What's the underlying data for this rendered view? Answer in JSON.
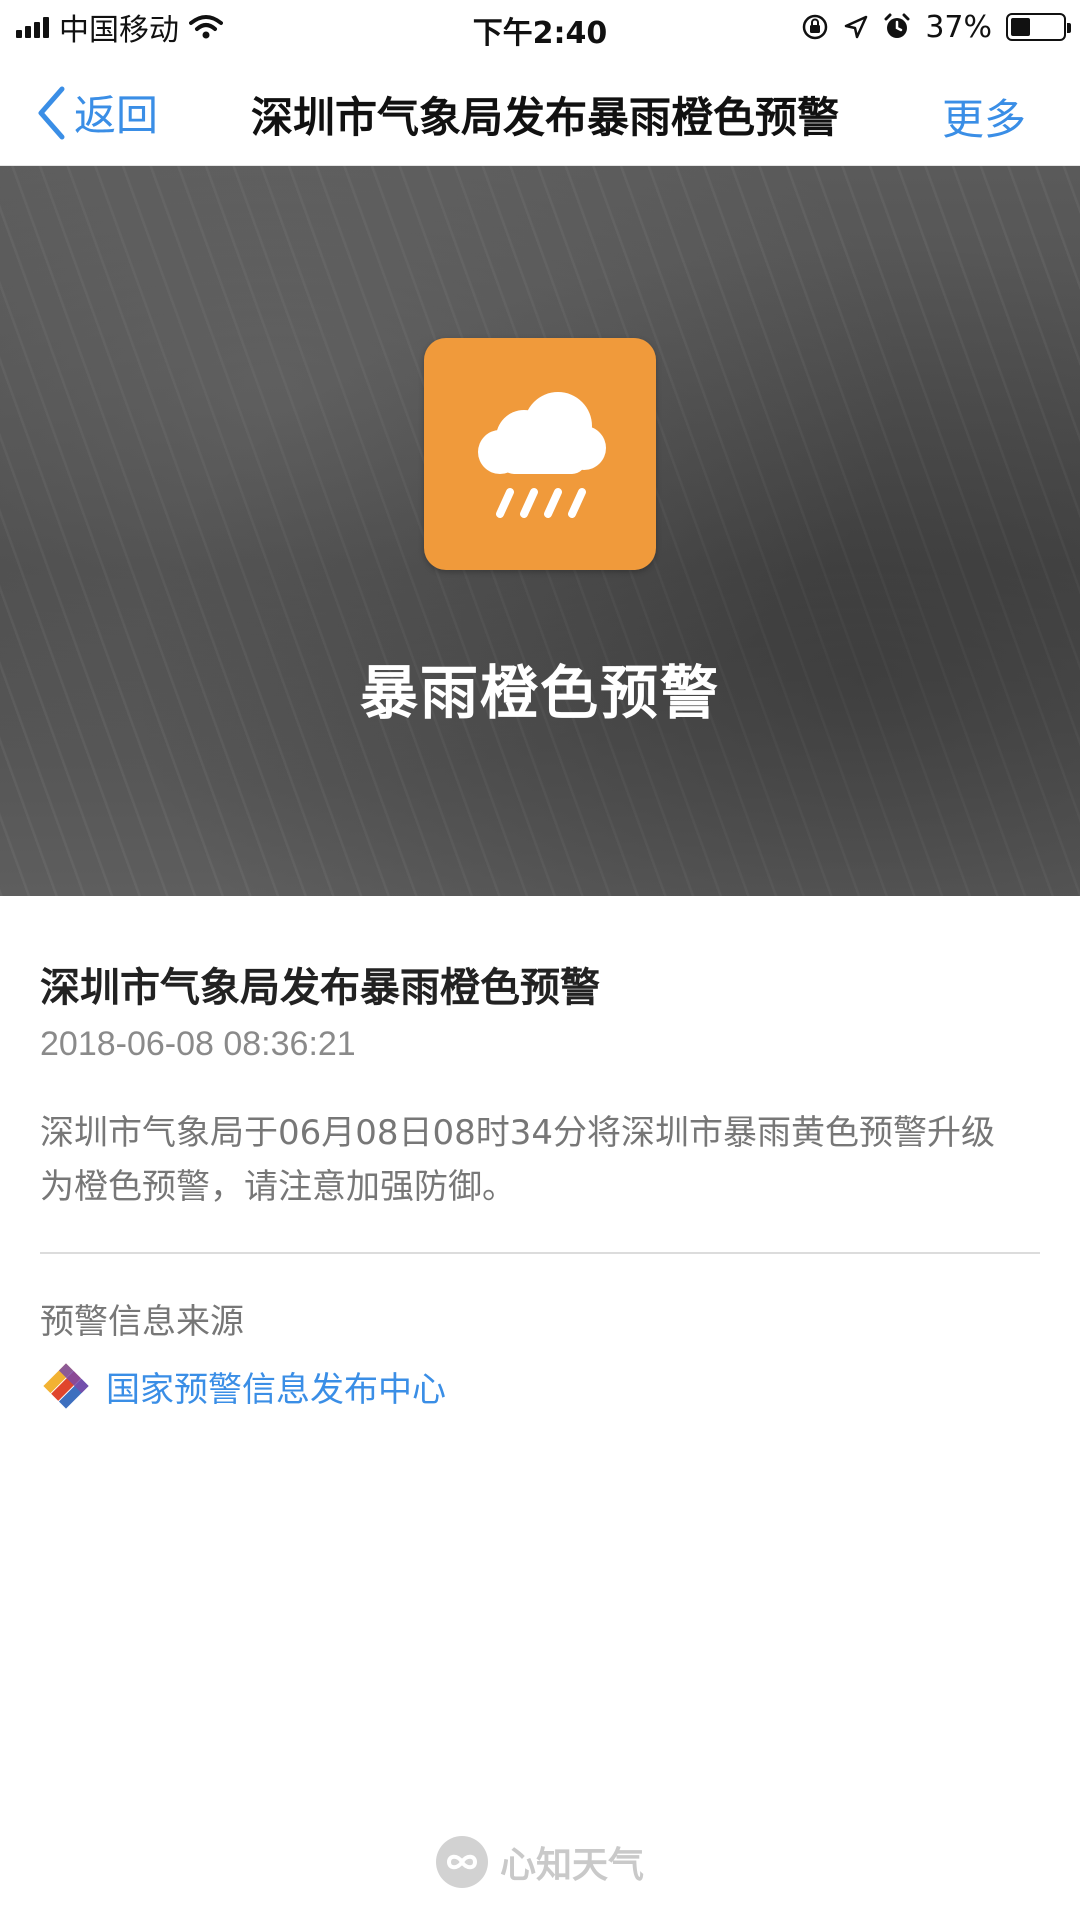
{
  "status_bar": {
    "carrier": "中国移动",
    "time": "下午2:40",
    "battery_percent": "37%",
    "battery_level": 0.37
  },
  "nav": {
    "back_label": "返回",
    "title": "深圳市气象局发布暴雨橙色预警",
    "more_label": "更多"
  },
  "hero": {
    "warning_title": "暴雨橙色预警",
    "badge_color": "#f09a3b",
    "badge_icon": "heavy-rain-cloud-icon"
  },
  "article": {
    "title": "深圳市气象局发布暴雨橙色预警",
    "timestamp": "2018-06-08 08:36:21",
    "body": "深圳市气象局于06月08日08时34分将深圳市暴雨黄色预警升级为橙色预警，请注意加强防御。"
  },
  "source": {
    "label": "预警信息来源",
    "name": "国家预警信息发布中心",
    "link_color": "#3a8ee6"
  },
  "footer": {
    "brand": "心知天气"
  }
}
